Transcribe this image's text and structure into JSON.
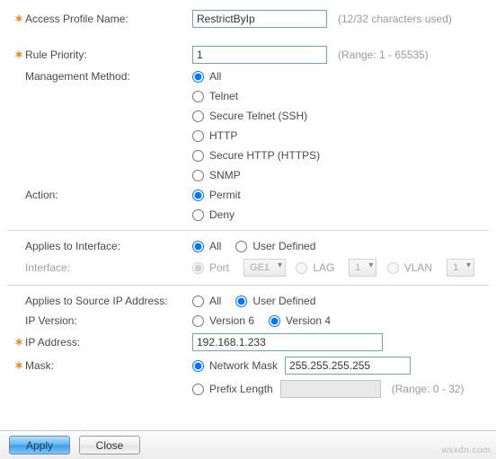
{
  "profileName": {
    "label": "Access Profile Name:",
    "value": "RestrictByIp",
    "hint": "(12/32 characters used)"
  },
  "rulePriority": {
    "label": "Rule Priority:",
    "value": "1",
    "hint": "(Range: 1 - 65535)"
  },
  "mgmtMethod": {
    "label": "Management Method:",
    "options": {
      "all": "All",
      "telnet": "Telnet",
      "ssh": "Secure Telnet (SSH)",
      "http": "HTTP",
      "https": "Secure HTTP (HTTPS)",
      "snmp": "SNMP"
    },
    "selected": "all"
  },
  "action": {
    "label": "Action:",
    "options": {
      "permit": "Permit",
      "deny": "Deny"
    },
    "selected": "permit"
  },
  "appliesInterface": {
    "label": "Applies to Interface:",
    "options": {
      "all": "All",
      "user": "User Defined"
    },
    "selected": "all"
  },
  "interfaceRow": {
    "label": "Interface:",
    "portLabel": "Port",
    "portValue": "GE1",
    "lagLabel": "LAG",
    "lagValue": "1",
    "vlanLabel": "VLAN",
    "vlanValue": "1"
  },
  "appliesSourceIp": {
    "label": "Applies to Source IP Address:",
    "options": {
      "all": "All",
      "user": "User Defined"
    },
    "selected": "user"
  },
  "ipVersion": {
    "label": "IP Version:",
    "options": {
      "v6": "Version 6",
      "v4": "Version 4"
    },
    "selected": "v4"
  },
  "ipAddress": {
    "label": "IP Address:",
    "value": "192.168.1.233"
  },
  "mask": {
    "label": "Mask:",
    "options": {
      "net": "Network Mask",
      "prefix": "Prefix Length"
    },
    "selected": "net",
    "netValue": "255.255.255.255",
    "prefixValue": "",
    "prefixHint": "(Range: 0 - 32)"
  },
  "footer": {
    "apply": "Apply",
    "close": "Close"
  },
  "watermark": "wsxdn.com"
}
